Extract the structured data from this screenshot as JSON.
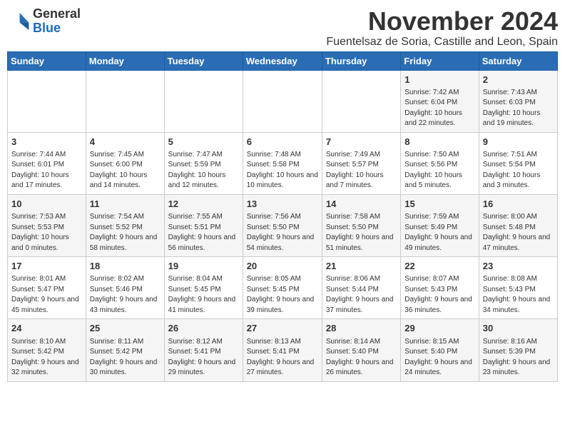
{
  "logo": {
    "general": "General",
    "blue": "Blue"
  },
  "header": {
    "month_year": "November 2024",
    "location": "Fuentelsaz de Soria, Castille and Leon, Spain"
  },
  "weekdays": [
    "Sunday",
    "Monday",
    "Tuesday",
    "Wednesday",
    "Thursday",
    "Friday",
    "Saturday"
  ],
  "weeks": [
    [
      {
        "day": "",
        "info": ""
      },
      {
        "day": "",
        "info": ""
      },
      {
        "day": "",
        "info": ""
      },
      {
        "day": "",
        "info": ""
      },
      {
        "day": "",
        "info": ""
      },
      {
        "day": "1",
        "info": "Sunrise: 7:42 AM\nSunset: 6:04 PM\nDaylight: 10 hours and 22 minutes."
      },
      {
        "day": "2",
        "info": "Sunrise: 7:43 AM\nSunset: 6:03 PM\nDaylight: 10 hours and 19 minutes."
      }
    ],
    [
      {
        "day": "3",
        "info": "Sunrise: 7:44 AM\nSunset: 6:01 PM\nDaylight: 10 hours and 17 minutes."
      },
      {
        "day": "4",
        "info": "Sunrise: 7:45 AM\nSunset: 6:00 PM\nDaylight: 10 hours and 14 minutes."
      },
      {
        "day": "5",
        "info": "Sunrise: 7:47 AM\nSunset: 5:59 PM\nDaylight: 10 hours and 12 minutes."
      },
      {
        "day": "6",
        "info": "Sunrise: 7:48 AM\nSunset: 5:58 PM\nDaylight: 10 hours and 10 minutes."
      },
      {
        "day": "7",
        "info": "Sunrise: 7:49 AM\nSunset: 5:57 PM\nDaylight: 10 hours and 7 minutes."
      },
      {
        "day": "8",
        "info": "Sunrise: 7:50 AM\nSunset: 5:56 PM\nDaylight: 10 hours and 5 minutes."
      },
      {
        "day": "9",
        "info": "Sunrise: 7:51 AM\nSunset: 5:54 PM\nDaylight: 10 hours and 3 minutes."
      }
    ],
    [
      {
        "day": "10",
        "info": "Sunrise: 7:53 AM\nSunset: 5:53 PM\nDaylight: 10 hours and 0 minutes."
      },
      {
        "day": "11",
        "info": "Sunrise: 7:54 AM\nSunset: 5:52 PM\nDaylight: 9 hours and 58 minutes."
      },
      {
        "day": "12",
        "info": "Sunrise: 7:55 AM\nSunset: 5:51 PM\nDaylight: 9 hours and 56 minutes."
      },
      {
        "day": "13",
        "info": "Sunrise: 7:56 AM\nSunset: 5:50 PM\nDaylight: 9 hours and 54 minutes."
      },
      {
        "day": "14",
        "info": "Sunrise: 7:58 AM\nSunset: 5:50 PM\nDaylight: 9 hours and 51 minutes."
      },
      {
        "day": "15",
        "info": "Sunrise: 7:59 AM\nSunset: 5:49 PM\nDaylight: 9 hours and 49 minutes."
      },
      {
        "day": "16",
        "info": "Sunrise: 8:00 AM\nSunset: 5:48 PM\nDaylight: 9 hours and 47 minutes."
      }
    ],
    [
      {
        "day": "17",
        "info": "Sunrise: 8:01 AM\nSunset: 5:47 PM\nDaylight: 9 hours and 45 minutes."
      },
      {
        "day": "18",
        "info": "Sunrise: 8:02 AM\nSunset: 5:46 PM\nDaylight: 9 hours and 43 minutes."
      },
      {
        "day": "19",
        "info": "Sunrise: 8:04 AM\nSunset: 5:45 PM\nDaylight: 9 hours and 41 minutes."
      },
      {
        "day": "20",
        "info": "Sunrise: 8:05 AM\nSunset: 5:45 PM\nDaylight: 9 hours and 39 minutes."
      },
      {
        "day": "21",
        "info": "Sunrise: 8:06 AM\nSunset: 5:44 PM\nDaylight: 9 hours and 37 minutes."
      },
      {
        "day": "22",
        "info": "Sunrise: 8:07 AM\nSunset: 5:43 PM\nDaylight: 9 hours and 36 minutes."
      },
      {
        "day": "23",
        "info": "Sunrise: 8:08 AM\nSunset: 5:43 PM\nDaylight: 9 hours and 34 minutes."
      }
    ],
    [
      {
        "day": "24",
        "info": "Sunrise: 8:10 AM\nSunset: 5:42 PM\nDaylight: 9 hours and 32 minutes."
      },
      {
        "day": "25",
        "info": "Sunrise: 8:11 AM\nSunset: 5:42 PM\nDaylight: 9 hours and 30 minutes."
      },
      {
        "day": "26",
        "info": "Sunrise: 8:12 AM\nSunset: 5:41 PM\nDaylight: 9 hours and 29 minutes."
      },
      {
        "day": "27",
        "info": "Sunrise: 8:13 AM\nSunset: 5:41 PM\nDaylight: 9 hours and 27 minutes."
      },
      {
        "day": "28",
        "info": "Sunrise: 8:14 AM\nSunset: 5:40 PM\nDaylight: 9 hours and 26 minutes."
      },
      {
        "day": "29",
        "info": "Sunrise: 8:15 AM\nSunset: 5:40 PM\nDaylight: 9 hours and 24 minutes."
      },
      {
        "day": "30",
        "info": "Sunrise: 8:16 AM\nSunset: 5:39 PM\nDaylight: 9 hours and 23 minutes."
      }
    ]
  ]
}
